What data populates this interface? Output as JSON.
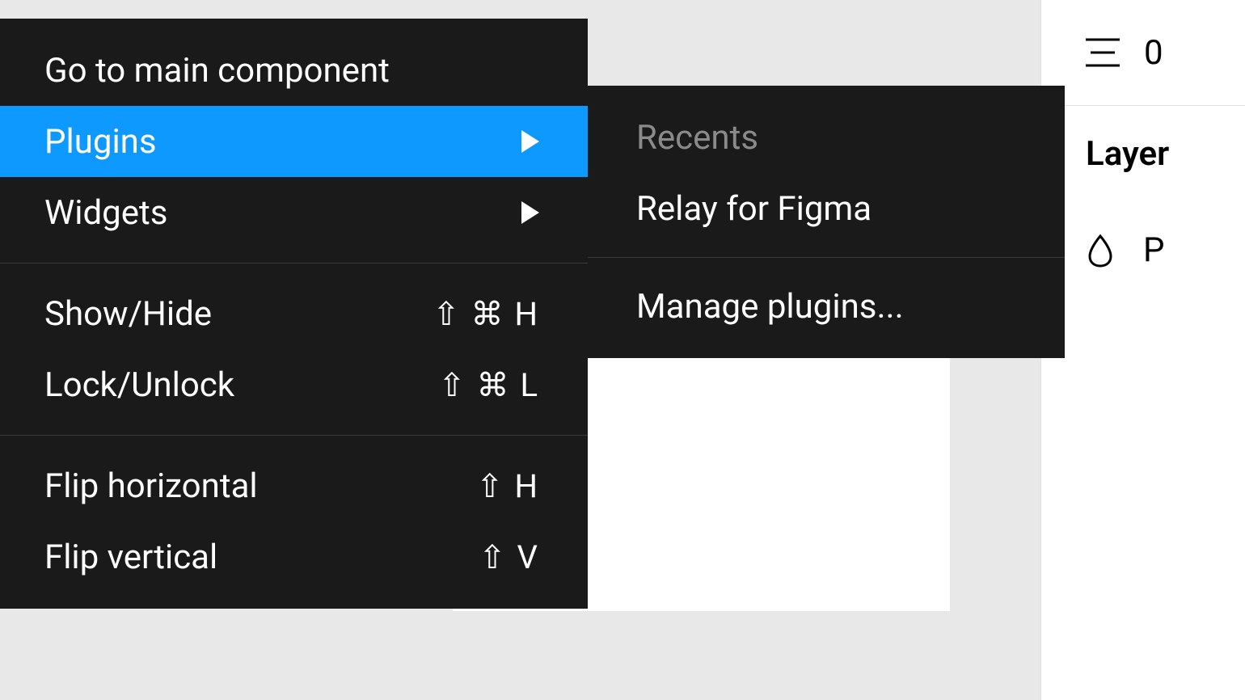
{
  "context_menu": {
    "go_to_main": "Go to main component",
    "plugins": "Plugins",
    "widgets": "Widgets",
    "show_hide": {
      "label": "Show/Hide",
      "shortcut": "⇧ ⌘ H"
    },
    "lock_unlock": {
      "label": "Lock/Unlock",
      "shortcut": "⇧ ⌘ L"
    },
    "flip_horizontal": {
      "label": "Flip horizontal",
      "shortcut": "⇧ H"
    },
    "flip_vertical": {
      "label": "Flip vertical",
      "shortcut": "⇧ V"
    }
  },
  "plugins_submenu": {
    "recents_header": "Recents",
    "relay": "Relay for Figma",
    "manage": "Manage plugins..."
  },
  "right_panel": {
    "top_value": "0",
    "layer_title": "Layer",
    "pass_through_initial": "P"
  }
}
